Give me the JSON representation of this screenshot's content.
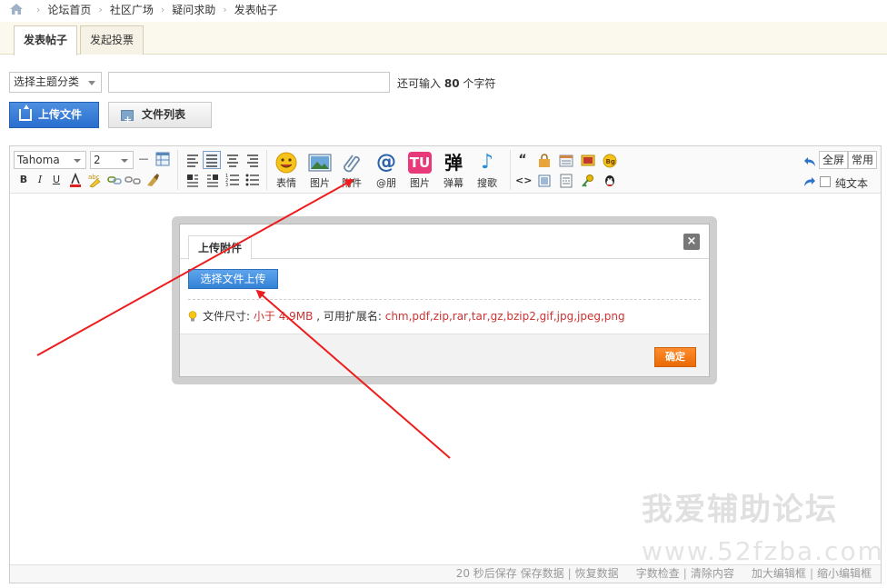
{
  "breadcrumb": [
    "论坛首页",
    "社区广场",
    "疑问求助",
    "发表帖子"
  ],
  "tabs": [
    {
      "label": "发表帖子",
      "active": true
    },
    {
      "label": "发起投票",
      "active": false
    }
  ],
  "subject": {
    "category_select": "选择主题分类",
    "title_value": "",
    "remain_prefix": "还可输入",
    "remain_count": "80",
    "remain_suffix": "个字符"
  },
  "buttons": {
    "upload_file": "上传文件",
    "file_list": "文件列表"
  },
  "editor": {
    "font_family": "Tahoma",
    "font_size": "2",
    "media_buttons": [
      {
        "label": "表情",
        "icon": "smiley-icon"
      },
      {
        "label": "图片",
        "icon": "image-icon"
      },
      {
        "label": "附件",
        "icon": "paperclip-icon"
      },
      {
        "label": "@朋",
        "icon": "at-icon"
      },
      {
        "label": "图片",
        "icon": "tu-image-icon"
      },
      {
        "label": "弹幕",
        "icon": "danmu-icon"
      },
      {
        "label": "搜歌",
        "icon": "music-note-icon"
      }
    ],
    "right_tools": {
      "fullscreen": "全屏",
      "common": "常用",
      "plain_text": "纯文本"
    }
  },
  "status_bar": {
    "autosave": "20 秒后保存",
    "save_data": "保存数据",
    "restore_data": "恢复数据",
    "word_check": "字数检查",
    "clear": "清除内容",
    "enlarge": "加大编辑框",
    "shrink": "缩小编辑框"
  },
  "dialog": {
    "tab_title": "上传附件",
    "close_glyph": "×",
    "choose_button": "选择文件上传",
    "info_label": "文件尺寸:",
    "size_limit": "小于 4.9MB",
    "ext_label": ", 可用扩展名:",
    "extensions": "chm,pdf,zip,rar,tar,gz,bzip2,gif,jpg,jpeg,png",
    "ok_button": "确定"
  },
  "watermark": {
    "line1": "我爱辅助论坛",
    "line2": "www.52fzba.com"
  },
  "colors": {
    "annotation_arrow": "#ee1c1c",
    "primary_blue": "#2a6fcf",
    "ok_orange": "#ea6a06",
    "dialog_frame": "#cfcfcf"
  }
}
